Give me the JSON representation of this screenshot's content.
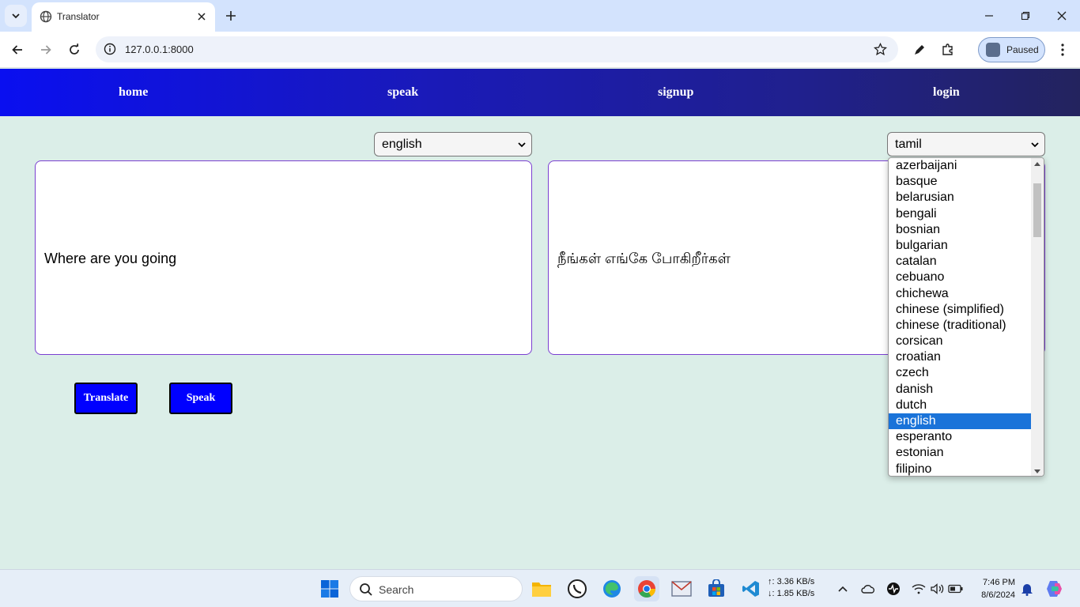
{
  "browser": {
    "tab_title": "Translator",
    "url": "127.0.0.1:8000",
    "profile_label": "Paused"
  },
  "nav": {
    "items": [
      {
        "label": "home"
      },
      {
        "label": "speak"
      },
      {
        "label": "signup"
      },
      {
        "label": "login"
      }
    ]
  },
  "translator": {
    "source_language": "english",
    "target_language": "tamil",
    "source_text": "Where are you going",
    "target_text": "நீங்கள் எங்கே போகிறீர்கள்",
    "translate_label": "Translate",
    "speak_label": "Speak",
    "dropdown_options": [
      "azerbaijani",
      "basque",
      "belarusian",
      "bengali",
      "bosnian",
      "bulgarian",
      "catalan",
      "cebuano",
      "chichewa",
      "chinese (simplified)",
      "chinese (traditional)",
      "corsican",
      "croatian",
      "czech",
      "danish",
      "dutch",
      "english",
      "esperanto",
      "estonian",
      "filipino"
    ],
    "dropdown_highlighted": "english"
  },
  "taskbar": {
    "search_label": "Search",
    "net_up": "↑: 3.36 KB/s",
    "net_down": "↓: 1.85 KB/s",
    "time": "7:46 PM",
    "date": "8/6/2024"
  },
  "colors": {
    "page_bg": "#dbeee8",
    "nav_start": "#0a0ff0",
    "nav_end": "#23235e",
    "button_bg": "#0000ff",
    "textbox_border": "#7b3fd1",
    "dropdown_highlight": "#1a73d9"
  }
}
